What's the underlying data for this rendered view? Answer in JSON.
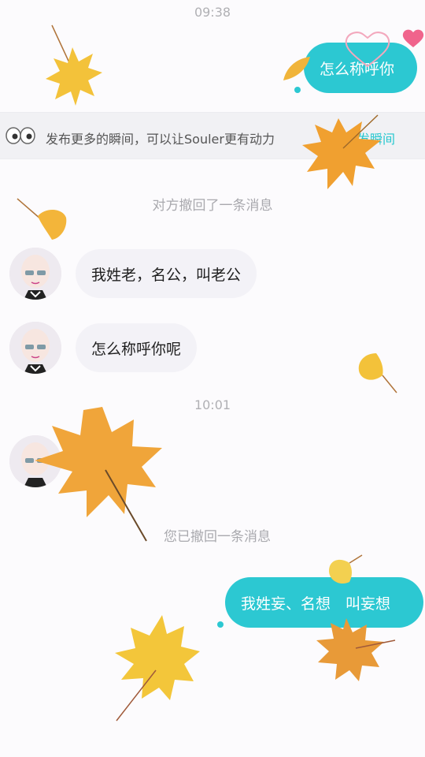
{
  "status_time_1": "09:38",
  "status_time_2": "10:01",
  "top_message": "怎么称呼你",
  "notice": {
    "text": "发布更多的瞬间，可以让Souler更有动力",
    "link": "发瞬间"
  },
  "system": {
    "recalled_other": "对方撤回了一条消息",
    "recalled_self": "您已撤回一条消息"
  },
  "messages": [
    {
      "text": "我姓老，名公，叫老公"
    },
    {
      "text": "怎么称呼你呢"
    }
  ],
  "last_message": "我姓妄、名想　叫妄想",
  "colors": {
    "accent": "#2cc8d2",
    "bubble_in": "#f3f2f7",
    "heart": "#f0648c",
    "leaf_orange": "#f0a030",
    "leaf_yellow": "#f3c23a"
  }
}
